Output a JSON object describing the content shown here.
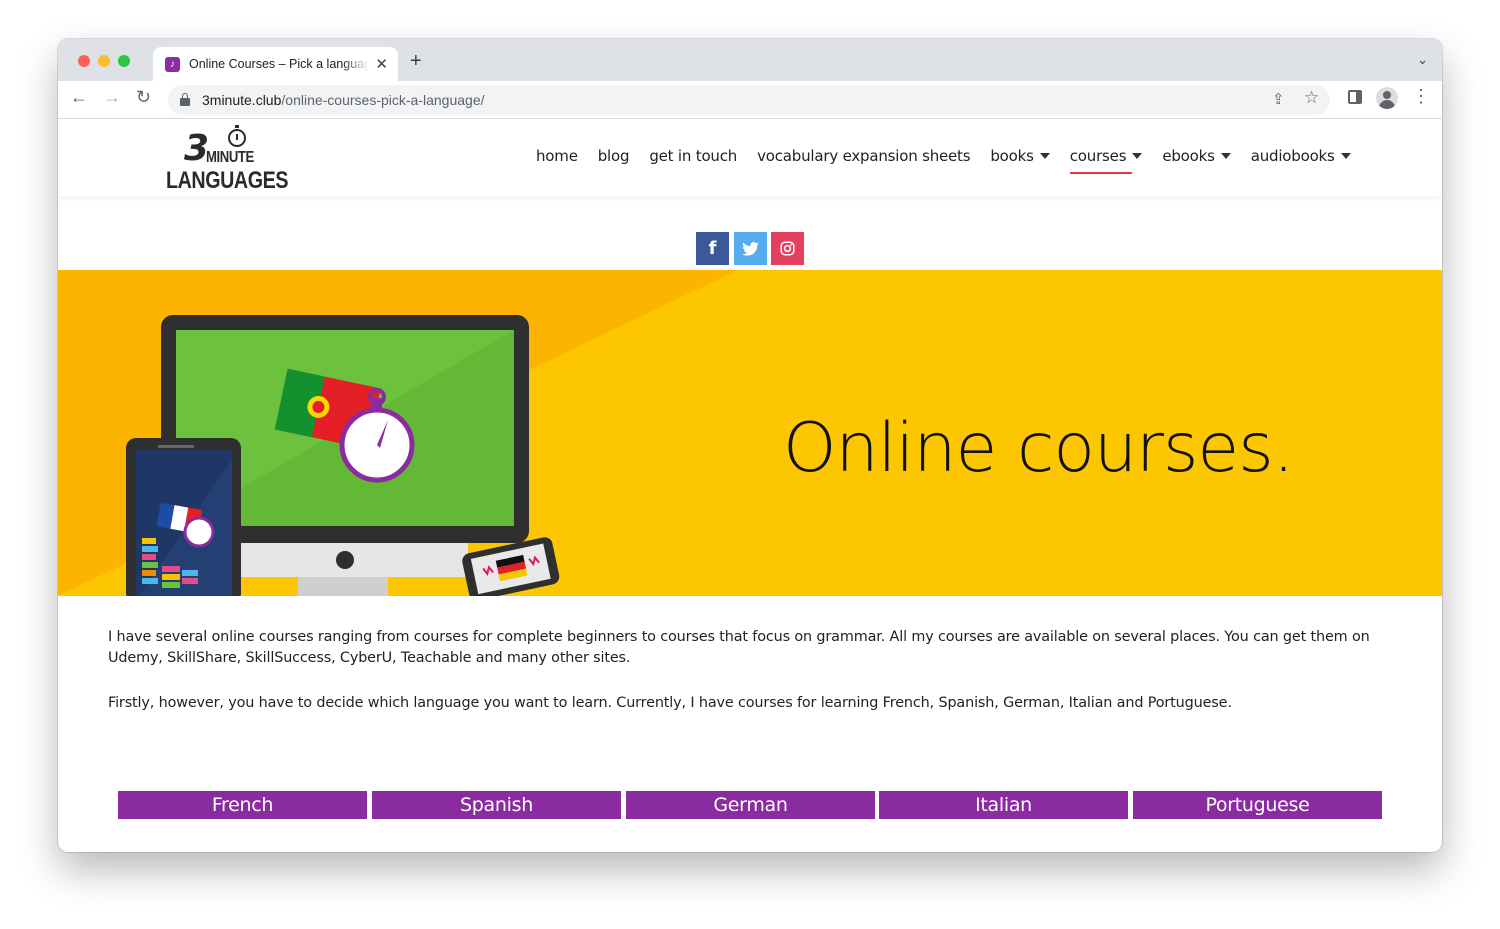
{
  "browser": {
    "tab_title": "Online Courses – Pick a language",
    "tab_close": "✕",
    "new_tab": "+",
    "url_host": "3minute.club",
    "url_path": "/online-courses-pick-a-language/"
  },
  "site": {
    "logo": {
      "number": "3",
      "word1": "MINUTE",
      "word2": "LANGUAGES"
    },
    "nav": [
      {
        "label": "home"
      },
      {
        "label": "blog"
      },
      {
        "label": "get in touch"
      },
      {
        "label": "vocabulary expansion sheets"
      },
      {
        "label": "books",
        "dropdown": true
      },
      {
        "label": "courses",
        "dropdown": true,
        "active": true
      },
      {
        "label": "ebooks",
        "dropdown": true
      },
      {
        "label": "audiobooks",
        "dropdown": true
      }
    ],
    "social": {
      "facebook": "f"
    },
    "colors": {
      "accent": "#8a2ba0",
      "hero": "#fcc700",
      "active_underline": "#e53935"
    }
  },
  "hero": {
    "title": "Online courses."
  },
  "content": {
    "paragraph1": "I have several online courses ranging from courses for complete beginners to courses that focus on grammar. All my courses are available on several places. You can get them on Udemy, SkillShare, SkillSuccess, CyberU, Teachable and many other sites.",
    "paragraph2": "Firstly, however, you have to decide which language you want to learn. Currently, I have courses for learning French, Spanish, German, Italian and Portuguese."
  },
  "languages": [
    "French",
    "Spanish",
    "German",
    "Italian",
    "Portuguese"
  ]
}
